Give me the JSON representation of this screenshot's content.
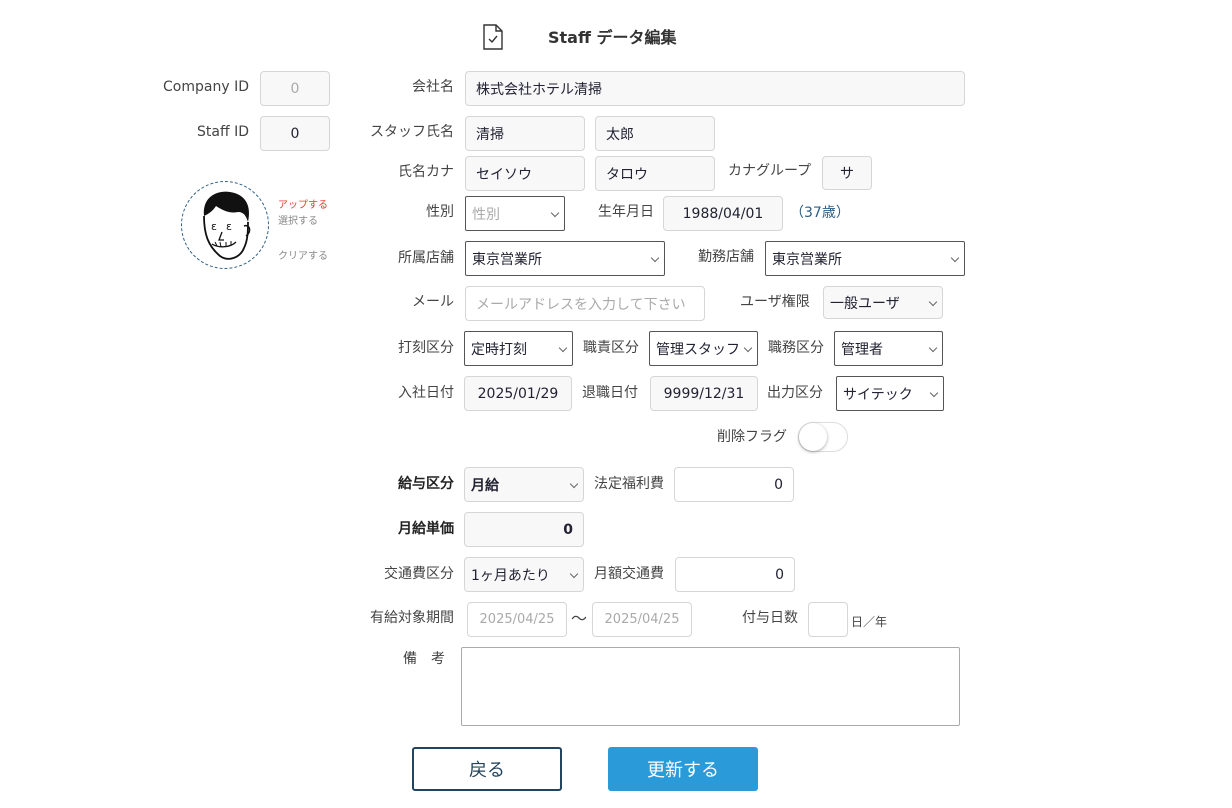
{
  "header": {
    "title": "Staff データ編集",
    "icon": "document-check-icon"
  },
  "left": {
    "company_id_label": "Company ID",
    "company_id_value": "0",
    "staff_id_label": "Staff ID",
    "staff_id_value": "0",
    "photo_links": {
      "upload": "アップする",
      "select": "選択する",
      "clear": "クリアする"
    }
  },
  "form": {
    "company_name_label": "会社名",
    "company_name": "株式会社ホテル清掃",
    "staff_name_label": "スタッフ氏名",
    "last_name": "清掃",
    "first_name": "太郎",
    "kana_label": "氏名カナ",
    "last_kana": "セイソウ",
    "first_kana": "タロウ",
    "kana_group_label": "カナグループ",
    "kana_group": "サ",
    "gender_label": "性別",
    "gender_value": "性別",
    "birthdate_label": "生年月日",
    "birthdate": "1988/04/01",
    "age": "（37歳）",
    "store_label": "所属店舗",
    "store_value": "東京営業所",
    "work_store_label": "勤務店舗",
    "work_store_value": "東京営業所",
    "email_label": "メール",
    "email_placeholder": "メールアドレスを入力して下さい",
    "user_role_label": "ユーザ権限",
    "user_role_value": "一般ユーザ",
    "clock_label": "打刻区分",
    "clock_value": "定時打刻",
    "position_label": "職責区分",
    "position_value": "管理スタッフ",
    "duty_label": "職務区分",
    "duty_value": "管理者",
    "hire_date_label": "入社日付",
    "hire_date": "2025/01/29",
    "retire_date_label": "退職日付",
    "retire_date": "9999/12/31",
    "output_label": "出力区分",
    "output_value": "サイテック",
    "delete_flag_label": "削除フラグ",
    "delete_flag_on": false,
    "salary_type_label": "給与区分",
    "salary_type_value": "月給",
    "welfare_label": "法定福利費",
    "welfare_value": "0",
    "monthly_unit_label": "月給単価",
    "monthly_unit_value": "0",
    "transport_type_label": "交通費区分",
    "transport_type_value": "1ヶ月あたり",
    "monthly_transport_label": "月額交通費",
    "monthly_transport_value": "0",
    "paid_leave_label": "有給対象期間",
    "paid_leave_from": "2025/04/25",
    "tilde": "〜",
    "paid_leave_to": "2025/04/25",
    "grant_days_label": "付与日数",
    "grant_days_value": "",
    "grant_days_unit": "日／年",
    "remarks_label": "備　考",
    "remarks_value": ""
  },
  "buttons": {
    "back": "戻る",
    "update": "更新する"
  }
}
